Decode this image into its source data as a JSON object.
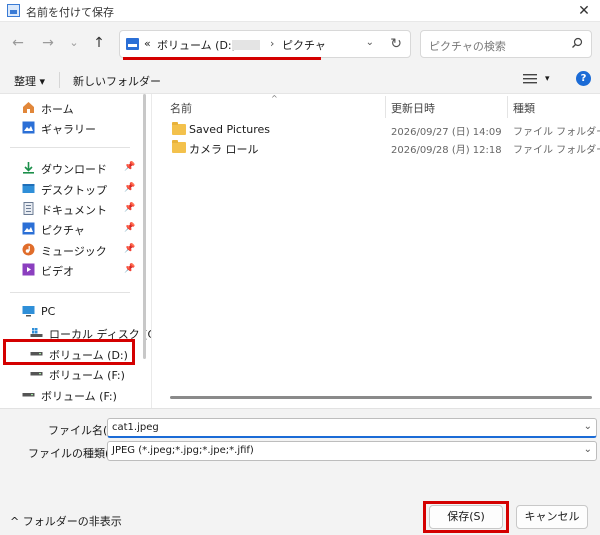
{
  "window": {
    "title": "名前を付けて保存",
    "close_glyph": "✕"
  },
  "nav": {
    "back": "←",
    "forward": "→",
    "history": "⌄",
    "up": "↑",
    "crumb_overflow": "«",
    "crumb_volume": "ボリューム (D:)",
    "crumb_sep1": "›",
    "crumb_sep2": "›",
    "crumb_current": "ピクチャ",
    "addr_chevron": "⌄",
    "refresh": "↻",
    "search_placeholder": "ピクチャの検索"
  },
  "toolbar": {
    "organize": "整理 ▾",
    "new_folder": "新しいフォルダー",
    "view_chevron": "▾",
    "help": "?"
  },
  "sidebar": {
    "pin_glyph": "📌",
    "items": [
      {
        "label": "ホーム",
        "icon": "home-icon",
        "color": "#e1873a"
      },
      {
        "label": "ギャラリー",
        "icon": "gallery-icon",
        "color": "#2b6fd6"
      },
      {
        "label": "ダウンロード",
        "icon": "download-icon",
        "color": "#1b8f4a"
      },
      {
        "label": "デスクトップ",
        "icon": "desktop-icon",
        "color": "#2f8fd8"
      },
      {
        "label": "ドキュメント",
        "icon": "documents-icon",
        "color": "#6b7b93"
      },
      {
        "label": "ピクチャ",
        "icon": "pictures-icon",
        "color": "#2b6fd6"
      },
      {
        "label": "ミュージック",
        "icon": "music-icon",
        "color": "#e06d2b"
      },
      {
        "label": "ビデオ",
        "icon": "video-icon",
        "color": "#8b3fbf"
      },
      {
        "label": "PC",
        "icon": "pc-icon",
        "color": "#2f8fd8"
      },
      {
        "label": "ローカル ディスク (C:)",
        "icon": "local-disk-icon",
        "color": "#555555"
      },
      {
        "label": "ボリューム (D:)",
        "icon": "drive-icon",
        "color": "#555555"
      },
      {
        "label": "ボリューム (F:)",
        "icon": "drive-icon",
        "color": "#555555"
      },
      {
        "label": "ボリューム (F:)",
        "icon": "drive-icon",
        "color": "#555555"
      }
    ]
  },
  "main": {
    "columns": {
      "name": "名前",
      "modified": "更新日時",
      "type": "種類"
    },
    "sort_arrow": "^",
    "rows": [
      {
        "name": "Saved Pictures",
        "modified": "2026/09/27 (日) 14:09",
        "type": "ファイル フォルダー"
      },
      {
        "name": "カメラ ロール",
        "modified": "2026/09/28 (月) 12:18",
        "type": "ファイル フォルダー"
      }
    ]
  },
  "form": {
    "filename_label": "ファイル名(N):",
    "filename_value": "cat1.jpeg",
    "filetype_label": "ファイルの種類(T):",
    "filetype_value": "JPEG (*.jpeg;*.jpg;*.jpe;*.jfif)",
    "dropdown_chevron": "⌄",
    "hide_folders": "^ フォルダーの非表示",
    "save_label": "保存(S)",
    "cancel_label": "キャンセル"
  },
  "colors": {
    "accent": "#1b6bd6",
    "highlight_red": "#d40000",
    "folder": "#f3c14c"
  }
}
